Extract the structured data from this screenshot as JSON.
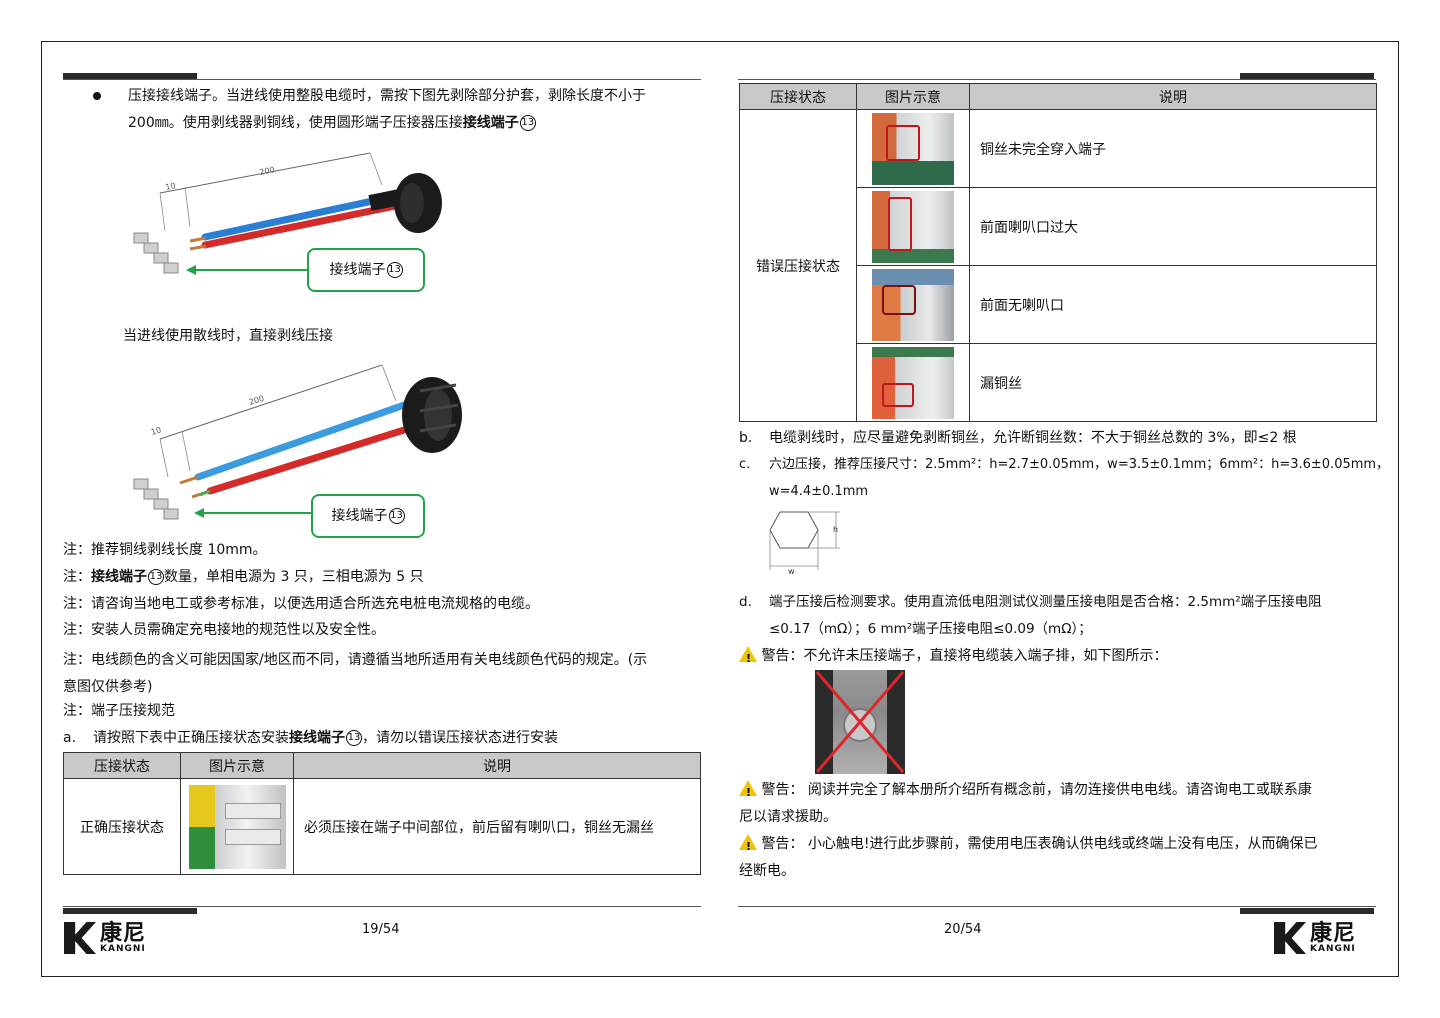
{
  "left_page": {
    "bullet_text_line1": "压接接线端子。当进线使用整股电缆时，需按下图先剥除部分护套，剥除长度不小于",
    "bullet_text_line2": "200㎜。使用剥线器剥铜线，使用圆形端子压接器压接",
    "terminal_bold": "接线端子",
    "circled_num": "13",
    "diagram1": {
      "dim_long": "200",
      "dim_short": "10",
      "callout": "接线端子"
    },
    "loose_wire_text": "当进线使用散线时，直接剥线压接",
    "diagram2": {
      "dim_long": "200",
      "dim_short": "10",
      "callout": "接线端子"
    },
    "note1": "注：推荐铜线剥线长度 10mm。",
    "note2_prefix": "注：",
    "note2_suffix": "数量，单相电源为 3 只，三相电源为 5 只",
    "note3": "注：请咨询当地电工或参考标准，以便选用适合所选充电桩电流规格的电缆。",
    "note4": "注：安装人员需确定充电接地的规范性以及安全性。",
    "note5_line1": "注：电线颜色的含义可能因国家/地区而不同，请遵循当地所适用有关电线颜色代码的规定。(示",
    "note5_line2": "意图仅供参考)",
    "note6": "注：端子压接规范",
    "item_a_label": "a.",
    "item_a_prefix": "请按照下表中正确压接状态安装",
    "item_a_suffix": "，请勿以错误压接状态进行安装",
    "table_headers": [
      "压接状态",
      "图片示意",
      "说明"
    ],
    "table_row": {
      "state": "正确压接状态",
      "desc": "必须压接在端子中间部位，前后留有喇叭口，铜丝无漏丝"
    },
    "page_number": "19/54"
  },
  "right_page": {
    "table_headers": [
      "压接状态",
      "图片示意",
      "说明"
    ],
    "wrong_state_label": "错误压接状态",
    "wrong_rows": [
      {
        "desc": "铜丝未完全穿入端子"
      },
      {
        "desc": "前面喇叭口过大"
      },
      {
        "desc": "前面无喇叭口"
      },
      {
        "desc": "漏铜丝"
      }
    ],
    "item_b_label": "b.",
    "item_b": "电缆剥线时，应尽量避免剥断铜丝，允许断铜丝数：不大于铜丝总数的 3%，即≤2 根",
    "item_c_label": "c.",
    "item_c_line1": "六边压接，推荐压接尺寸：2.5mm²：h=2.7±0.05mm，w=3.5±0.1mm；6mm²：h=3.6±0.05mm，",
    "item_c_line2": "w=4.4±0.1mm",
    "hex_h": "h",
    "hex_w": "w",
    "item_d_label": "d.",
    "item_d_line1": "端子压接后检测要求。使用直流低电阻测试仪测量压接电阻是否合格：2.5mm²端子压接电阻",
    "item_d_line2": "≤0.17（mΩ）；6 mm²端子压接电阻≤0.09（mΩ）；",
    "warning1": "警告：不允许未压接端子，直接将电缆装入端子排，如下图所示：",
    "warning2_line1": "警告：  阅读并完全了解本册所介绍所有概念前，请勿连接供电电线。请咨询电工或联系康",
    "warning2_line2": "尼以请求援助。",
    "warning3_line1": "警告：  小心触电!进行此步骤前，需使用电压表确认供电线或终端上没有电压，从而确保已",
    "warning3_line2": "经断电。",
    "page_number": "20/54"
  },
  "logo": {
    "cn": "康尼",
    "en": "KANGNI"
  },
  "colors": {
    "callout_green": "#22a24a",
    "header_gray": "#c9c9c9",
    "warning_yellow": "#f0c400",
    "wire_blue": "#2a7fd4",
    "wire_red": "#d42a2a"
  }
}
